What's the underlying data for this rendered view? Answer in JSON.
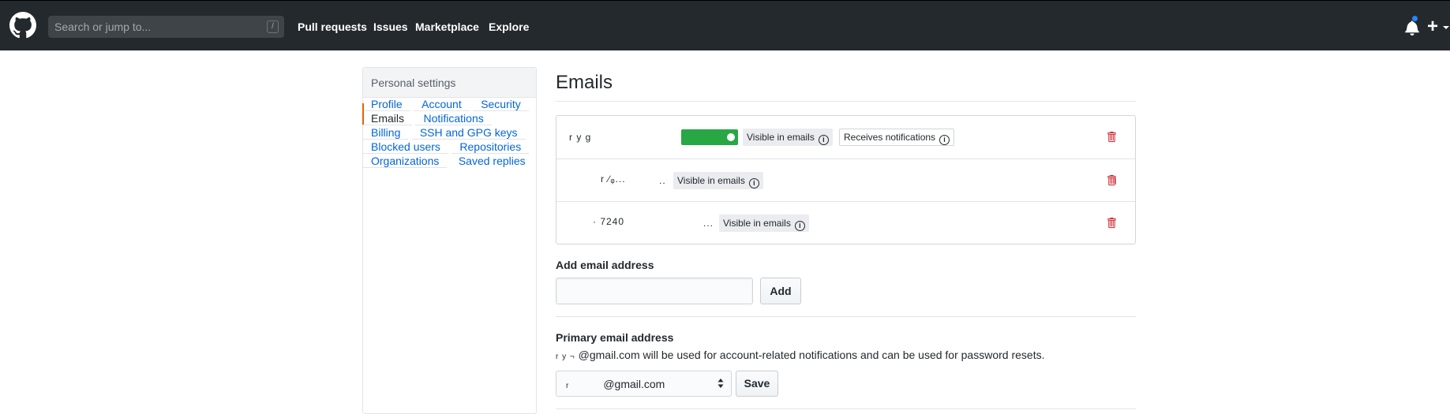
{
  "header": {
    "search_placeholder": "Search or jump to...",
    "search_shortcut": "/",
    "nav": [
      "Pull requests",
      "Issues",
      "Marketplace",
      "Explore"
    ],
    "plus_label": "+"
  },
  "sidebar": {
    "heading": "Personal settings",
    "items": [
      {
        "label": "Profile"
      },
      {
        "label": "Account"
      },
      {
        "label": "Security"
      },
      {
        "label": "Emails",
        "active": true
      },
      {
        "label": "Notifications"
      },
      {
        "label": "Billing"
      },
      {
        "label": "SSH and GPG keys"
      },
      {
        "label": "Blocked users"
      },
      {
        "label": "Repositories"
      },
      {
        "label": "Organizations"
      },
      {
        "label": "Saved replies"
      }
    ]
  },
  "main": {
    "title": "Emails",
    "emails": [
      {
        "address": "r  y              g",
        "badges": [
          "Visible in emails",
          "Receives notifications"
        ]
      },
      {
        "address": "r  ∕ᵩ...",
        "trail": "..",
        "badges": [
          "Visible in emails"
        ]
      },
      {
        "address": "    ·    7240",
        "trail": "...",
        "badges": [
          "Visible in emails"
        ]
      }
    ],
    "info_glyph": "i",
    "add_email": {
      "label": "Add email address",
      "value": "",
      "button": "Add"
    },
    "primary": {
      "label": "Primary email address",
      "description_prefix": "r  y    ¬",
      "description": "@gmail.com will be used for account-related notifications and can be used for password resets.",
      "selected_prefix": "r",
      "selected": "@gmail.com",
      "save_button": "Save"
    }
  },
  "colors": {
    "header_bg": "#24292e",
    "link": "#0366d6",
    "active_marker": "#e36209",
    "danger": "#cb2431",
    "notification_dot": "#2188ff",
    "redaction_green": "#28a745"
  }
}
